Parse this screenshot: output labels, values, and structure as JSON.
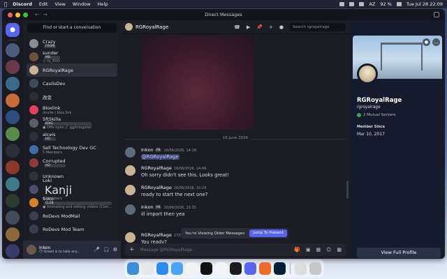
{
  "menubar": {
    "app": "Discord",
    "menus": [
      "Edit",
      "View",
      "Window",
      "Help"
    ],
    "battery": "92 %",
    "input": "AZ",
    "clock": "Tue Jul 28  22:09"
  },
  "window": {
    "title": "Direct Messages"
  },
  "dm_list": {
    "search_label": "Find or start a conversation",
    "items": [
      {
        "name": "Crazy",
        "tag": "FROM",
        "sub": "",
        "color": "#8a8d95"
      },
      {
        "name": "sunder",
        "tag": "MD",
        "sub": "♫ lly_EVO",
        "color": "#6b4f3f"
      },
      {
        "name": "RGRoyalRage",
        "tag": "",
        "sub": "",
        "color": "#c9b395"
      },
      {
        "name": "CaulisDev",
        "tag": "",
        "sub": "",
        "color": "#3e4a5a"
      },
      {
        "name": "改变",
        "tag": "",
        "sub": "",
        "color": "#2b2d36"
      },
      {
        "name": "Bloxlink",
        "tag": "",
        "sub": "/invite | blox.link",
        "color": "#e4405f"
      },
      {
        "name": "5ft5killa",
        "tag": "KRIG",
        "sub": "● DMs open // .gg/kriegsfall",
        "color": "#5b5f68"
      },
      {
        "name": "alceis",
        "tag": "HD",
        "sub": "",
        "color": "#2a2f3a"
      },
      {
        "name": "Sell Technology Dev GC",
        "tag": "",
        "sub": "5 Members",
        "color": "#3a6ea5"
      },
      {
        "name": "Corrupted",
        "tag": "HD",
        "sub": "",
        "color": "#8f3a3a"
      },
      {
        "name": "Unknown",
        "tag": "",
        "sub": "",
        "color": "#2f3136"
      },
      {
        "name": "Loki",
        "tag": "",
        "sub": "3 Members",
        "color": "#4a4f6a",
        "extra": "Kanji"
      },
      {
        "name": "Suco",
        "tag": "CLEB",
        "sub": "● Animating and editing videos (Com...",
        "color": "#d9822b"
      },
      {
        "name": "RoDevs ModMail",
        "tag": "",
        "sub": "",
        "color": "#3a3f4c"
      },
      {
        "name": "RoDevs Mod Team",
        "tag": "",
        "sub": "",
        "color": "#3a3f4c"
      }
    ]
  },
  "user_panel": {
    "name": "Inkon",
    "status": "😶 Greed is to take any..."
  },
  "chat": {
    "header_name": "RGRoyalRage",
    "search_placeholder": "Search rgroyalrage",
    "date_divider": "16 June 2026",
    "messages": [
      {
        "author": "Inkon",
        "tag": "PB",
        "time": "16/06/2026, 14:18",
        "text": "@RGRoyalRage",
        "color": "#5b6b7b"
      },
      {
        "author": "RGRoyalRage",
        "tag": "",
        "time": "16/06/2026, 14:49",
        "text": "Oh sorry didn't see this. Looks great!",
        "color": "#c9b395"
      },
      {
        "author": "RGRoyalRage",
        "tag": "",
        "time": "16/06/2026, 15:24",
        "text": "ready to start the next one?",
        "color": "#c9b395"
      },
      {
        "author": "Inkon",
        "tag": "PB",
        "time": "16/06/2026, 15:35",
        "text": "ill import then yea",
        "color": "#5b6b7b"
      },
      {
        "author": "RGRoyalRage",
        "tag": "",
        "time": "17/0",
        "text": "You ready?",
        "color": "#c9b395"
      }
    ],
    "older_notice": "You're Viewing Older Messages",
    "jump_label": "Jump To Present",
    "composer_placeholder": "Message @RGRoyalRage"
  },
  "profile": {
    "name": "RGRoyalRage",
    "username": "rgroyalrage",
    "mutual": "2 Mutual Servers",
    "member_since_label": "Member Since",
    "member_since": "Mar 10, 2017",
    "button": "View Full Profile"
  },
  "colors": {
    "accent": "#5865f2",
    "background": "#1b1c24",
    "sidebar": "#1d1e25"
  }
}
